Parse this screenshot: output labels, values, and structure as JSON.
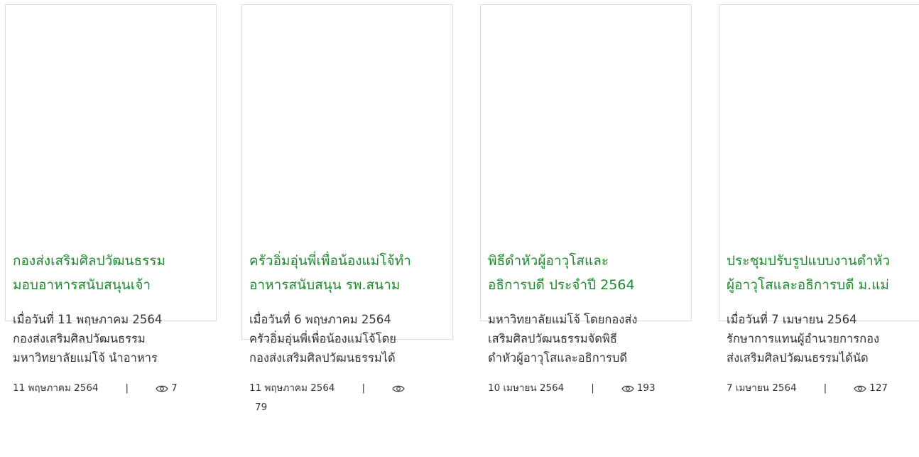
{
  "cards": [
    {
      "title_line1": "กองส่งเสริมศิลปวัฒนธรรม",
      "title_line2": "มอบอาหารสนับสนุนเจ้า",
      "excerpt_line1": "เมื่อวันที่ 11 พฤษภาคม 2564",
      "excerpt_line2": "กองส่งเสริมศิลปวัฒนธรรม",
      "excerpt_line3": "มหาวิทยาลัยแม่โจ้ นำอาหาร",
      "date": "11 พฤษภาคม 2564",
      "separator": "|",
      "views": "7"
    },
    {
      "title_line1": "ครัวอิ่มอุ่นพี่เพื่อน้องแม่โจ้ทำ",
      "title_line2": "อาหารสนับสนุน รพ.สนาม",
      "excerpt_line1": "เมื่อวันที่ 6 พฤษภาคม 2564",
      "excerpt_line2": "ครัวอิ่มอุ่นพี่เพื่อน้องแม่โจ้โดย",
      "excerpt_line3": "กองส่งเสริมศิลปวัฒนธรรมได้",
      "date": "11 พฤษภาคม 2564",
      "separator": "|",
      "views": "79"
    },
    {
      "title_line1": "พิธีดำหัวผู้อาวุโสและ",
      "title_line2": "อธิการบดี ประจำปี 2564",
      "excerpt_line1": "มหาวิทยาลัยแม่โจ้ โดยกองส่ง",
      "excerpt_line2": "เสริมศิลปวัฒนธรรมจัดพิธี",
      "excerpt_line3": "ดำหัวผู้อาวุโสและอธิการบดี",
      "date": "10 เมษายน 2564",
      "separator": "|",
      "views": "193"
    },
    {
      "title_line1": "ประชุมปรับรูปแบบงานดำหัว",
      "title_line2": "ผู้อาวุโสและอธิการบดี ม.แม่",
      "excerpt_line1": "เมื่อวันที่ 7 เมษายน 2564",
      "excerpt_line2": "รักษาการแทนผู้อำนวยการกอง",
      "excerpt_line3": "ส่งเสริมศิลปวัฒนธรรมได้นัด",
      "date": "7 เมษายน 2564",
      "separator": "|",
      "views": "127"
    }
  ],
  "colors": {
    "title": "#1f8a2e",
    "text": "#333333",
    "border": "#dcdcdc"
  },
  "icons": {
    "views": "eye-icon"
  }
}
